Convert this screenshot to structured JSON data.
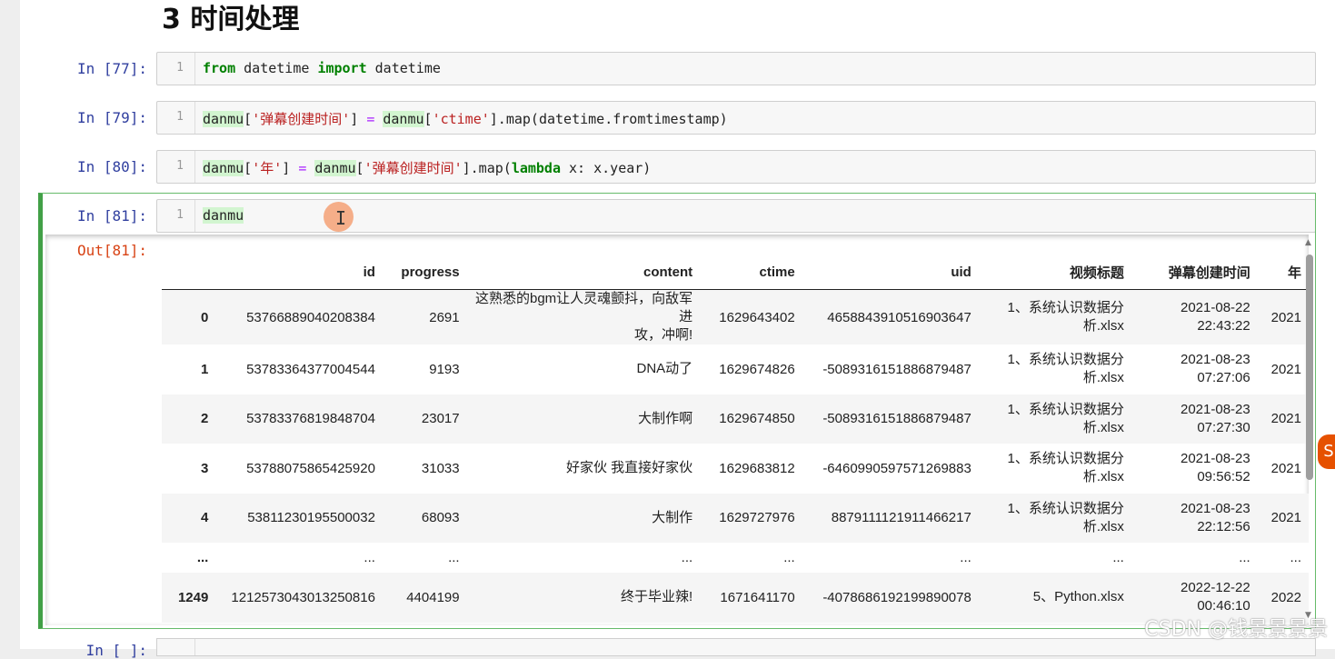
{
  "section_heading": "3  时间处理",
  "cells": [
    {
      "prompt": "In  [77]:",
      "line_no": "1",
      "code": [
        {
          "t": "from",
          "c": "kw"
        },
        {
          "t": " datetime ",
          "c": ""
        },
        {
          "t": "import",
          "c": "kw"
        },
        {
          "t": " datetime",
          "c": ""
        }
      ]
    },
    {
      "prompt": "In  [79]:",
      "line_no": "1",
      "code": [
        {
          "t": "danmu",
          "c": "hl"
        },
        {
          "t": "[",
          "c": ""
        },
        {
          "t": "'弹幕创建时间'",
          "c": "str"
        },
        {
          "t": "] ",
          "c": ""
        },
        {
          "t": "=",
          "c": "op"
        },
        {
          "t": " ",
          "c": ""
        },
        {
          "t": "danmu",
          "c": "hl"
        },
        {
          "t": "[",
          "c": ""
        },
        {
          "t": "'ctime'",
          "c": "str"
        },
        {
          "t": "].map(datetime.fromtimestamp)",
          "c": ""
        }
      ]
    },
    {
      "prompt": "In  [80]:",
      "line_no": "1",
      "code": [
        {
          "t": "danmu",
          "c": "hl"
        },
        {
          "t": "[",
          "c": ""
        },
        {
          "t": "'年'",
          "c": "str"
        },
        {
          "t": "] ",
          "c": ""
        },
        {
          "t": "=",
          "c": "op"
        },
        {
          "t": " ",
          "c": ""
        },
        {
          "t": "danmu",
          "c": "hl"
        },
        {
          "t": "[",
          "c": ""
        },
        {
          "t": "'弹幕创建时间'",
          "c": "str"
        },
        {
          "t": "].map(",
          "c": ""
        },
        {
          "t": "lambda",
          "c": "kw"
        },
        {
          "t": " x: x.year)",
          "c": ""
        }
      ]
    },
    {
      "prompt": "In  [81]:",
      "line_no": "1",
      "code": [
        {
          "t": "danmu",
          "c": "hl"
        }
      ]
    }
  ],
  "output": {
    "prompt": "Out[81]:",
    "columns": [
      "",
      "id",
      "progress",
      "content",
      "ctime",
      "uid",
      "视频标题",
      "弹幕创建时间",
      "年"
    ],
    "rows": [
      {
        "index": "0",
        "id": "53766889040208384",
        "progress": "2691",
        "content": [
          "这熟悉的bgm让人灵魂颤抖，向敌军进",
          "攻，冲啊!"
        ],
        "ctime": "1629643402",
        "uid": "4658843910516903647",
        "title": [
          "1、系统认识数据分",
          "析.xlsx"
        ],
        "created": [
          "2021-08-22",
          "22:43:22"
        ],
        "year": "2021"
      },
      {
        "index": "1",
        "id": "53783364377004544",
        "progress": "9193",
        "content": [
          "DNA动了"
        ],
        "ctime": "1629674826",
        "uid": "-5089316151886879487",
        "title": [
          "1、系统认识数据分",
          "析.xlsx"
        ],
        "created": [
          "2021-08-23",
          "07:27:06"
        ],
        "year": "2021"
      },
      {
        "index": "2",
        "id": "53783376819848704",
        "progress": "23017",
        "content": [
          "大制作啊"
        ],
        "ctime": "1629674850",
        "uid": "-5089316151886879487",
        "title": [
          "1、系统认识数据分",
          "析.xlsx"
        ],
        "created": [
          "2021-08-23",
          "07:27:30"
        ],
        "year": "2021"
      },
      {
        "index": "3",
        "id": "53788075865425920",
        "progress": "31033",
        "content": [
          "好家伙 我直接好家伙"
        ],
        "ctime": "1629683812",
        "uid": "-6460990597571269883",
        "title": [
          "1、系统认识数据分",
          "析.xlsx"
        ],
        "created": [
          "2021-08-23",
          "09:56:52"
        ],
        "year": "2021"
      },
      {
        "index": "4",
        "id": "53811230195500032",
        "progress": "68093",
        "content": [
          "大制作"
        ],
        "ctime": "1629727976",
        "uid": "8879111121911466217",
        "title": [
          "1、系统认识数据分",
          "析.xlsx"
        ],
        "created": [
          "2021-08-23",
          "22:12:56"
        ],
        "year": "2021"
      }
    ],
    "ellipsis_row": [
      "...",
      "...",
      "...",
      "...",
      "...",
      "...",
      "...",
      "...",
      "..."
    ],
    "last_row": {
      "index": "1249",
      "id": "1212573043013250816",
      "progress": "4404199",
      "content": [
        "终于毕业辣!"
      ],
      "ctime": "1671641170",
      "uid": "-4078686192199890078",
      "title": [
        "5、Python.xlsx"
      ],
      "created": [
        "2022-12-22",
        "00:46:10"
      ],
      "year": "2022"
    }
  },
  "watermark": "CSDN @钱景景景景",
  "icons": {
    "cursor": "text-cursor-icon",
    "edge": "side-widget-icon",
    "scroll_up": "scroll-up-arrow-icon",
    "scroll_down": "scroll-down-arrow-icon"
  }
}
